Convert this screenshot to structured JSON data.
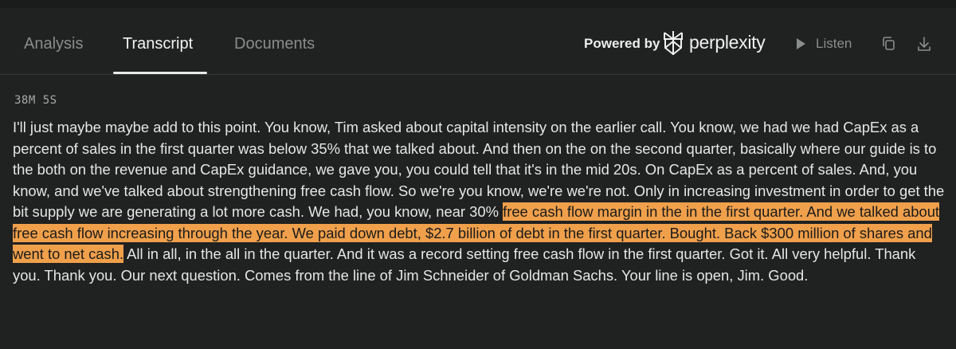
{
  "tabs": [
    {
      "label": "Analysis",
      "active": false
    },
    {
      "label": "Transcript",
      "active": true
    },
    {
      "label": "Documents",
      "active": false
    }
  ],
  "branding": {
    "powered_by": "Powered by",
    "brand_name": "perplexity"
  },
  "toolbar": {
    "listen_label": "Listen",
    "icons": [
      "play-icon",
      "copy-icon",
      "download-icon"
    ]
  },
  "transcript": {
    "timestamp": "38M 5S",
    "text_before": "I'll just maybe maybe add to this point. You know, Tim asked about capital intensity on the earlier call. You know, we had we had CapEx as a percent of sales in the first quarter was below 35% that we talked about. And then on the on the second quarter, basically where our guide is to the both on the revenue and CapEx guidance, we gave you, you could tell that it's in the mid 20s. On CapEx as a percent of sales. And, you know, and we've talked about strengthening free cash flow. So we're you know, we're we're not. Only in increasing investment in order to get the bit supply we are generating a lot more cash. We had, you know, near 30% ",
    "text_highlighted": "free cash flow margin in the in the first quarter. And we talked about free cash flow increasing through the year. We paid down debt, $2.7 billion of debt in the first quarter. Bought. Back $300 million of shares and went to net cash.",
    "text_after": " All in all, in the all in the quarter. And it was a record setting free cash flow in the first quarter. Got it. All very helpful. Thank you. Thank you. Our next question. Comes from the line of Jim Schneider of Goldman Sachs. Your line is open, Jim. Good."
  },
  "colors": {
    "background": "#202121",
    "highlight": "#f0a04b",
    "text": "#e6e6e6",
    "muted": "#8a8d8d"
  }
}
